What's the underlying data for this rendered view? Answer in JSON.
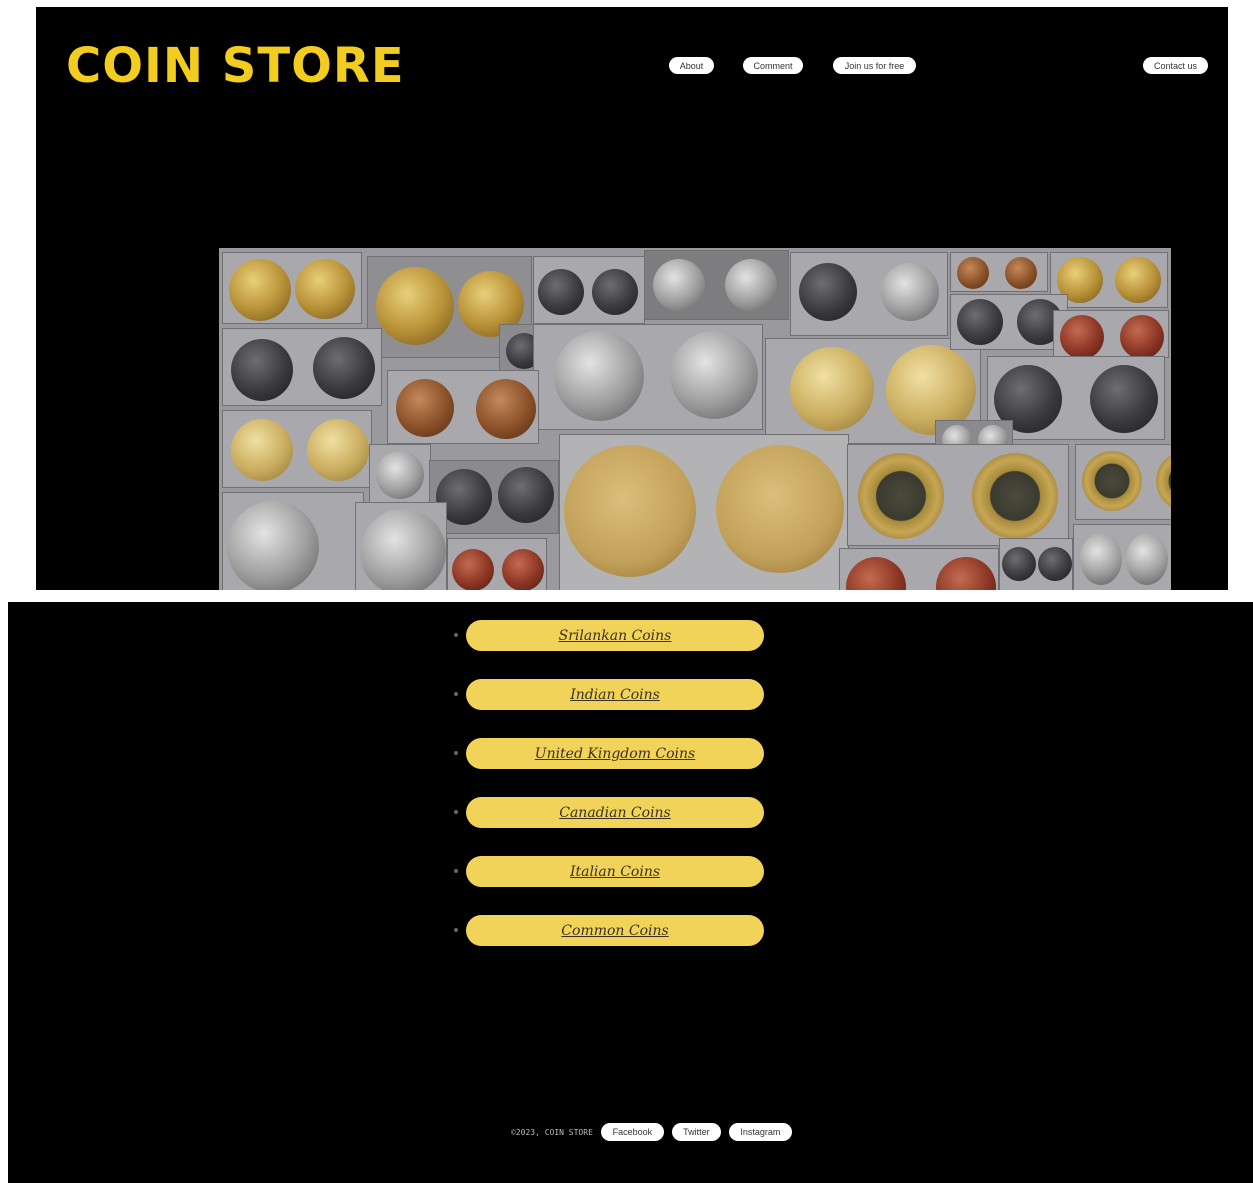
{
  "header": {
    "logo": "COIN STORE",
    "nav": {
      "about": "About",
      "comment": "Comment",
      "join": "Join us for free",
      "contact": "Contact us"
    }
  },
  "hero": {
    "image_alt": "Collage of coins"
  },
  "coin_categories": [
    "Srilankan Coins",
    "Indian Coins",
    "United Kingdom Coins",
    "Canadian Coins",
    "Italian Coins",
    "Common Coins"
  ],
  "footer": {
    "copyright": "©2023, COIN STORE",
    "social": {
      "facebook": "Facebook",
      "twitter": "Twitter",
      "instagram": "Instagram"
    }
  },
  "colors": {
    "background": "#000000",
    "accent_yellow": "#f2cc1f",
    "button_yellow": "#f2d35a",
    "pill_white": "#ffffff"
  }
}
